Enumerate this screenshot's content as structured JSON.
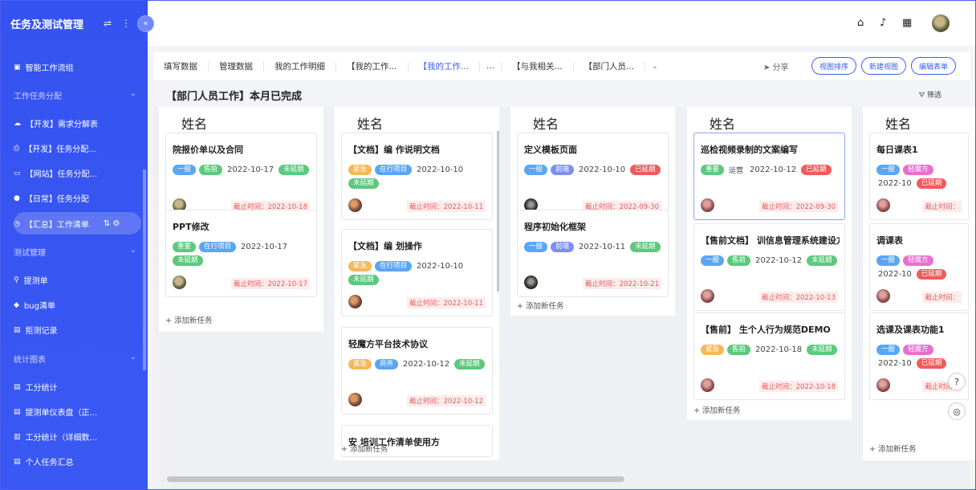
{
  "app": {
    "title": "任务及测试管理"
  },
  "sidebar": {
    "items": [
      {
        "label": "智能工作流组",
        "icon": "grid-icon"
      },
      {
        "label": "工作任务分配",
        "group": true
      },
      {
        "label": "【开发】需求分解表",
        "icon": "cloud-icon"
      },
      {
        "label": "【开发】任务分配...",
        "icon": "print-icon"
      },
      {
        "label": "【网站】任务分配...",
        "icon": "monitor-icon"
      },
      {
        "label": "【日常】任务分配",
        "icon": "circle-icon"
      },
      {
        "label": "【汇总】工作清单",
        "icon": "clock-icon",
        "active": true
      },
      {
        "label": "测试管理",
        "group": true
      },
      {
        "label": "提测单",
        "icon": "link-icon"
      },
      {
        "label": "bug清单",
        "icon": "tag-icon"
      },
      {
        "label": "拒测记录",
        "icon": "doc-icon"
      },
      {
        "label": "统计图表",
        "group": true
      },
      {
        "label": "工分统计",
        "icon": "list-icon"
      },
      {
        "label": "提测单仪表盘（正...",
        "icon": "list-icon"
      },
      {
        "label": "工分统计（详细数...",
        "icon": "book-icon"
      },
      {
        "label": "个人任务汇总",
        "icon": "list-icon"
      }
    ]
  },
  "tabs": [
    "填写数据",
    "管理数据",
    "我的工作明细",
    "【我的工作...",
    "【我的工作...",
    "…",
    "【与我相关...",
    "【部门人员..."
  ],
  "toolbar": {
    "share": "分享",
    "sort_view": "视图排序",
    "new_view": "新建视图",
    "edit_list": "编辑表单"
  },
  "page_title": "【部门人员工作】本月已完成",
  "filter_label": "筛选",
  "add_task": "添加新任务",
  "columns": [
    {
      "name": "姓名",
      "cards": [
        {
          "title": "院报价单以及合同",
          "tags": [
            [
              "一般",
              "#5aa6f5"
            ],
            [
              "售前",
              "#5cc97d"
            ]
          ],
          "date": "2022-10-17",
          "status": [
            "未延期",
            "#5cc97d"
          ],
          "deadline": "截止时间：2022-10-18",
          "av": ""
        },
        {
          "title": "PPT修改",
          "tags": [
            [
              "重要",
              "#5cc97d"
            ],
            [
              "在行项目",
              "#5aa6f5"
            ]
          ],
          "date": "2022-10-17",
          "status": [
            "未延期",
            "#5cc97d"
          ],
          "deadline": "截止时间：2022-10-17",
          "av": ""
        }
      ]
    },
    {
      "name": "姓名",
      "cards": [
        {
          "title": "【文档】编          作说明文档",
          "tags": [
            [
              "紧急",
              "#f5b85a"
            ],
            [
              "在行项目",
              "#5aa6f5"
            ]
          ],
          "date": "2022-10-10",
          "status": [
            "未延期",
            "#5cc97d"
          ],
          "deadline": "截止时间：2022-10-11",
          "av": "av2"
        },
        {
          "title": "【文档】编          划操作",
          "tags": [
            [
              "紧急",
              "#f5b85a"
            ],
            [
              "在行项目",
              "#5aa6f5"
            ]
          ],
          "date": "2022-10-10",
          "status": [
            "未延期",
            "#5cc97d"
          ],
          "deadline": "截止时间：2022-10-11",
          "av": "av2"
        },
        {
          "title": "轻魔方平台技术协议",
          "tags": [
            [
              "紧急",
              "#f5b85a"
            ],
            [
              "商务",
              "#5aa6f5"
            ]
          ],
          "date": "2022-10-12",
          "status": [
            "未延期",
            "#5cc97d"
          ],
          "deadline": "截止时间：2022-10-12",
          "av": "av2"
        },
        {
          "title": "安          培训工作清单使用方",
          "tags": [],
          "date": "",
          "status": null,
          "deadline": "",
          "av": ""
        }
      ]
    },
    {
      "name": "姓名",
      "cards": [
        {
          "title": "定义模板页面",
          "tags": [
            [
              "一般",
              "#5aa6f5"
            ],
            [
              "前端",
              "#7b8ff5"
            ]
          ],
          "date": "2022-10-10",
          "status": [
            "已延期",
            "#ef5b5b"
          ],
          "deadline": "截止时间：2022-09-30",
          "av": "av3"
        },
        {
          "title": "程序初始化框架",
          "tags": [
            [
              "一般",
              "#5aa6f5"
            ],
            [
              "前端",
              "#7b8ff5"
            ]
          ],
          "date": "2022-10-11",
          "status": [
            "未延期",
            "#5cc97d"
          ],
          "deadline": "截止时间：2022-10-21",
          "av": "av3"
        }
      ]
    },
    {
      "name": "姓名",
      "cards": [
        {
          "title": "巡检视频录制的文案编写",
          "tags": [
            [
              "重要",
              "#5cc97d"
            ]
          ],
          "plain": "运营",
          "date": "2022-10-12",
          "status": [
            "已延期",
            "#ef5b5b"
          ],
          "deadline": "截止时间：2022-09-30",
          "av": "av4"
        },
        {
          "title": "【售前文档】       训信息管理系统建设方案",
          "tags": [
            [
              "一般",
              "#5aa6f5"
            ],
            [
              "售前",
              "#5cc97d"
            ]
          ],
          "date": "2022-10-12",
          "status": [
            "未延期",
            "#5cc97d"
          ],
          "deadline": "截止时间：2022-10-13",
          "av": "av4"
        },
        {
          "title": "【售前】          生个人行为规范DEMO",
          "tags": [
            [
              "紧急",
              "#f5b85a"
            ],
            [
              "售前",
              "#5cc97d"
            ]
          ],
          "date": "2022-10-18",
          "status": [
            "未延期",
            "#5cc97d"
          ],
          "deadline": "截止时间：2022-10-18",
          "av": "av4"
        }
      ]
    },
    {
      "name": "姓名",
      "cards": [
        {
          "title": "每日课表1",
          "tags": [
            [
              "一般",
              "#5aa6f5"
            ],
            [
              "轻魔方",
              "#e86fcf"
            ]
          ],
          "date": "2022-10",
          "status": [
            "已延期",
            "#ef5b5b"
          ],
          "deadline": "截止时间：",
          "av": "av4"
        },
        {
          "title": "调课表",
          "tags": [
            [
              "一般",
              "#5aa6f5"
            ],
            [
              "轻魔方",
              "#e86fcf"
            ]
          ],
          "date": "2022-10",
          "status": [
            "已延期",
            "#ef5b5b"
          ],
          "deadline": "截止时间：",
          "av": "av4"
        },
        {
          "title": "选课及课表功能1",
          "tags": [
            [
              "一般",
              "#5aa6f5"
            ],
            [
              "轻魔方",
              "#e86fcf"
            ]
          ],
          "date": "2022-10",
          "status": [
            "已延期",
            "#ef5b5b"
          ],
          "deadline": "截止时间：",
          "av": "av4"
        }
      ]
    }
  ]
}
